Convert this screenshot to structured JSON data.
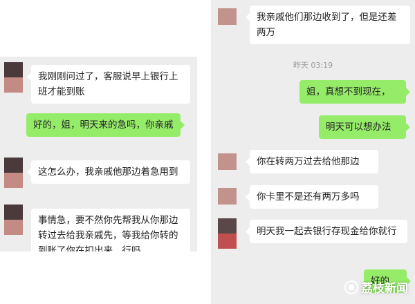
{
  "left_chat": {
    "messages": [
      {
        "side": "in",
        "text": "我刚刚问过了，客服说早上银行上班才能到账"
      },
      {
        "side": "out",
        "text": "好的，姐，明天来的急吗，你亲戚"
      },
      {
        "side": "in",
        "text": "这怎么办，我亲戚他那边着急用到"
      },
      {
        "side": "in",
        "text": "事情急，要不然你先帮我从你那边转过去给我亲戚先，等我给你转的到账了你在扣出来，行吗"
      }
    ]
  },
  "right_chat": {
    "messages": [
      {
        "side": "in",
        "text": "我亲戚他们那边收到了，但是还差两万"
      },
      {
        "side": "out",
        "text": "姐，真想不到现在，"
      },
      {
        "side": "out",
        "text": "明天可以想办法"
      },
      {
        "side": "in",
        "text": "你在转两万过去给他那边"
      },
      {
        "side": "in",
        "text": "你卡里不是还有两万多吗"
      },
      {
        "side": "in",
        "text": "明天我一起去银行存现金给你就行"
      },
      {
        "side": "out",
        "text": "好的"
      }
    ],
    "timestamp": "昨天 03:19"
  },
  "watermark": {
    "text": "荔枝新闻"
  },
  "colors": {
    "outgoing": "#95ec69",
    "incoming": "#ffffff",
    "background": "#ededed"
  }
}
